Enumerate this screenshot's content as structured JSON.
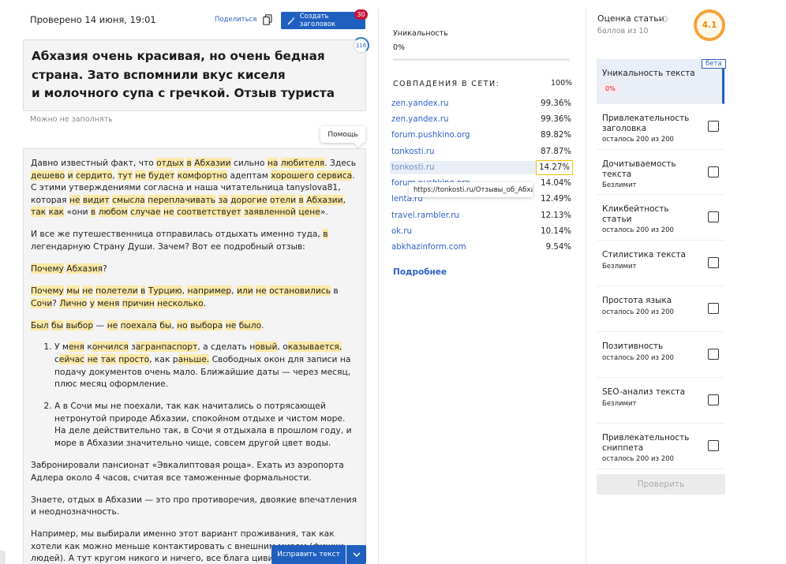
{
  "header": {
    "checked_at": "Проверено 14 июня, 19:01",
    "share_label": "Поделиться",
    "copy_icon": "copy-icon",
    "create_title_label": "Создать заголовок",
    "create_title_badge": "30"
  },
  "editor": {
    "title": "Абхазия очень красивая, но очень бедная\nстрана. Зато вспомнили вкус киселя\nи молочного супа с гречкой. Отзыв туриста",
    "title_counter": "116",
    "hint": "Можно не заполнять",
    "help_label": "Помощь",
    "fix_button_label": "Исправить текст"
  },
  "uniqueness": {
    "label": "Уникальность",
    "value": "0%",
    "fill_fraction": 0.0
  },
  "matches": {
    "title": "СОВПАДЕНИЯ В СЕТИ:",
    "total": "100%",
    "items": [
      {
        "source": "zen.yandex.ru",
        "percent": "99.36%"
      },
      {
        "source": "zen.yandex.ru",
        "percent": "99.36%"
      },
      {
        "source": "forum.pushkino.org",
        "percent": "89.82%"
      },
      {
        "source": "tonkosti.ru",
        "percent": "87.87%"
      },
      {
        "source": "tonkosti.ru",
        "percent": "14.27%",
        "active": true
      },
      {
        "source": "forum.pushkino.org",
        "percent": "14.04%"
      },
      {
        "source": "lenta.ru",
        "percent": "12.49%"
      },
      {
        "source": "travel.rambler.ru",
        "percent": "12.13%"
      },
      {
        "source": "ok.ru",
        "percent": "10.14%"
      },
      {
        "source": "abkhazinform.com",
        "percent": "9.54%"
      }
    ],
    "tooltip_url": "https://tonkosti.ru/Отзывы_об_Абхазии",
    "more_label": "Подробнее"
  },
  "score": {
    "title": "Оценка статьи",
    "subtitle": "баллов из 10",
    "value": "4.1"
  },
  "checks": {
    "beta_label": "бета",
    "items": [
      {
        "name": "Уникальность текста",
        "badge": "0%"
      },
      {
        "name": "Привлекательность заголовка",
        "sub": "осталось 200 из 200"
      },
      {
        "name": "Дочитываемость текста",
        "sub": "Безлимит"
      },
      {
        "name": "Кликбейтность статьи",
        "sub": "осталось 200 из 200"
      },
      {
        "name": "Стилистика текста",
        "sub": "Безлимит"
      },
      {
        "name": "Простота языка",
        "sub": "осталось 200 из 200"
      },
      {
        "name": "Позитивность",
        "sub": "осталось 200 из 200"
      },
      {
        "name": "SEO-анализ текста",
        "sub": "Безлимит"
      },
      {
        "name": "Привлекательность сниппета",
        "sub": "осталось 200 из 200"
      }
    ],
    "check_button_label": "Проверить"
  },
  "colors": {
    "accent": "#1f5fbf",
    "link": "#2d5fc4",
    "highlight": "#fbe9a6",
    "badge_red": "#c8143c",
    "score_orange": "#f4a43a"
  },
  "article": {
    "p1": [
      {
        "t": "Давно известный факт, что "
      },
      {
        "t": "отдых",
        "h": 1
      },
      {
        "t": " "
      },
      {
        "t": "в",
        "h": 1
      },
      {
        "t": " "
      },
      {
        "t": "Абхазии",
        "h": 1
      },
      {
        "t": " сильно "
      },
      {
        "t": "на",
        "h": 1
      },
      {
        "t": " "
      },
      {
        "t": "любителя",
        "h": 1
      },
      {
        "t": ". Здесь "
      },
      {
        "t": "дешево",
        "h": 1
      },
      {
        "t": " "
      },
      {
        "t": "и",
        "h": 1
      },
      {
        "t": " "
      },
      {
        "t": "сердито",
        "h": 1
      },
      {
        "t": ", "
      },
      {
        "t": "тут",
        "h": 1
      },
      {
        "t": " "
      },
      {
        "t": "не",
        "h": 1
      },
      {
        "t": " "
      },
      {
        "t": "будет",
        "h": 1
      },
      {
        "t": " "
      },
      {
        "t": "комфортно",
        "h": 1
      },
      {
        "t": " адептам "
      },
      {
        "t": "хорошего",
        "h": 1
      },
      {
        "t": " "
      },
      {
        "t": "сервиса",
        "h": 1
      },
      {
        "t": ". С этими утверждениями согласна и наша читательница tanyslova81, которая "
      },
      {
        "t": "не",
        "h": 1
      },
      {
        "t": " "
      },
      {
        "t": "видит",
        "h": 1
      },
      {
        "t": " "
      },
      {
        "t": "смысла",
        "h": 1
      },
      {
        "t": " "
      },
      {
        "t": "переплачивать",
        "h": 1
      },
      {
        "t": " "
      },
      {
        "t": "за",
        "h": 1
      },
      {
        "t": " "
      },
      {
        "t": "дорогие",
        "h": 1
      },
      {
        "t": " "
      },
      {
        "t": "отели",
        "h": 1
      },
      {
        "t": " "
      },
      {
        "t": "в",
        "h": 1
      },
      {
        "t": " "
      },
      {
        "t": "Абхазии",
        "h": 1
      },
      {
        "t": ", "
      },
      {
        "t": "так",
        "h": 1
      },
      {
        "t": " "
      },
      {
        "t": "как",
        "h": 1
      },
      {
        "t": " «они "
      },
      {
        "t": "в",
        "h": 1
      },
      {
        "t": " "
      },
      {
        "t": "любом",
        "h": 1
      },
      {
        "t": " "
      },
      {
        "t": "случае",
        "h": 1
      },
      {
        "t": " "
      },
      {
        "t": "не",
        "h": 1
      },
      {
        "t": " "
      },
      {
        "t": "соответствует",
        "h": 1
      },
      {
        "t": " "
      },
      {
        "t": "заявленной",
        "h": 1
      },
      {
        "t": " "
      },
      {
        "t": "цене",
        "h": 1
      },
      {
        "t": "»."
      }
    ],
    "p2": [
      {
        "t": "И все же путешественница отправилась отдыхать именно туда, "
      },
      {
        "t": "в",
        "h": 1
      },
      {
        "t": " легендарную Страну Души. Зачем? Вот ее подробный отзыв:"
      }
    ],
    "p3": [
      {
        "t": "Почему",
        "h": 1
      },
      {
        "t": " "
      },
      {
        "t": "Абхазия",
        "h": 1
      },
      {
        "t": "?"
      }
    ],
    "p4": [
      {
        "t": "Почему",
        "h": 1
      },
      {
        "t": " "
      },
      {
        "t": "мы",
        "h": 1
      },
      {
        "t": " "
      },
      {
        "t": "не",
        "h": 1
      },
      {
        "t": " "
      },
      {
        "t": "полетели",
        "h": 1
      },
      {
        "t": " "
      },
      {
        "t": "в",
        "h": 1
      },
      {
        "t": " "
      },
      {
        "t": "Турцию",
        "h": 1
      },
      {
        "t": ", "
      },
      {
        "t": "например",
        "h": 1
      },
      {
        "t": ", "
      },
      {
        "t": "или",
        "h": 1
      },
      {
        "t": " "
      },
      {
        "t": "не",
        "h": 1
      },
      {
        "t": " "
      },
      {
        "t": "остановились",
        "h": 1
      },
      {
        "t": " в "
      },
      {
        "t": "Сочи",
        "h": 1
      },
      {
        "t": "? "
      },
      {
        "t": "Лично",
        "h": 1
      },
      {
        "t": " "
      },
      {
        "t": "у",
        "h": 1
      },
      {
        "t": " "
      },
      {
        "t": "меня",
        "h": 1
      },
      {
        "t": " "
      },
      {
        "t": "причин",
        "h": 1
      },
      {
        "t": " "
      },
      {
        "t": "несколько",
        "h": 1
      },
      {
        "t": "."
      }
    ],
    "p5": [
      {
        "t": "Был",
        "h": 1
      },
      {
        "t": " "
      },
      {
        "t": "бы",
        "h": 1
      },
      {
        "t": " "
      },
      {
        "t": "выбор",
        "h": 1
      },
      {
        "t": " — "
      },
      {
        "t": "не",
        "h": 1
      },
      {
        "t": " "
      },
      {
        "t": "поехала",
        "h": 1
      },
      {
        "t": " "
      },
      {
        "t": "бы",
        "h": 1
      },
      {
        "t": ", "
      },
      {
        "t": "но",
        "h": 1
      },
      {
        "t": " "
      },
      {
        "t": "выбора",
        "h": 1
      },
      {
        "t": " "
      },
      {
        "t": "не",
        "h": 1
      },
      {
        "t": " "
      },
      {
        "t": "было",
        "h": 1
      },
      {
        "t": "."
      }
    ],
    "li1": [
      {
        "t": "У м"
      },
      {
        "t": "еня",
        "h": 1
      },
      {
        "t": " к"
      },
      {
        "t": "ончился",
        "h": 1
      },
      {
        "t": " з"
      },
      {
        "t": "агранпаспорт",
        "h": 1
      },
      {
        "t": ", а сделать н"
      },
      {
        "t": "овый",
        "h": 1
      },
      {
        "t": ", о"
      },
      {
        "t": "казывается,",
        "h": 1
      },
      {
        "t": " с"
      },
      {
        "t": "ейчас",
        "h": 1
      },
      {
        "t": " "
      },
      {
        "t": "не",
        "h": 1
      },
      {
        "t": " "
      },
      {
        "t": "так",
        "h": 1
      },
      {
        "t": " "
      },
      {
        "t": "просто",
        "h": 1
      },
      {
        "t": ", как р"
      },
      {
        "t": "аньше.",
        "h": 1
      },
      {
        "t": " Свободных окон для записи на подачу документов очень мало. Ближайшие даты — через месяц, плюс месяц оформление."
      }
    ],
    "li2": [
      {
        "t": "А в Сочи мы не поехали, так как начитались о потрясающей нетронутой природе Абхазии, спокойном отдыхе и чистом море. На деле действительно так, в Сочи я отдыхала в прошлом году, и море в Абхазии значительно чище, совсем другой цвет воды."
      }
    ],
    "p6": [
      {
        "t": "Забронировали пансионат «Эвкалиптовая роща». Ехать из аэропорта Адлера около 4 часов, считая все таможенные формальности."
      }
    ],
    "p7": [
      {
        "t": "Знаете, отдых в Абхазии — это про противоречия, двоякие впечатления и неоднозначность."
      }
    ],
    "p8": [
      {
        "t": "Например, мы выбирали именно этот вариант проживания, так как хотели как можно меньше контактировать с внешним миром (фишки людей). А тут кругом никого и ничего, все блага цивилизации"
      }
    ]
  }
}
